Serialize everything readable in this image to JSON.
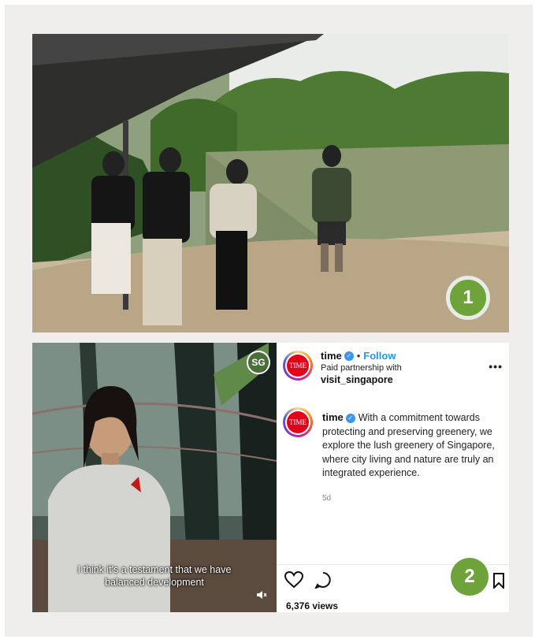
{
  "badges": {
    "first": "1",
    "second": "2"
  },
  "video": {
    "channel_badge": "SG",
    "caption_line1": "I think it's a testament that we have",
    "caption_line2": "balanced development"
  },
  "post": {
    "username": "time",
    "verified_mark": "✓",
    "separator": "•",
    "follow_label": "Follow",
    "partnership_label": "Paid partnership with",
    "partner_name": "visit_singapore",
    "avatar_text": "TIME",
    "caption_username": "time",
    "caption_text": "With a commitment towards protecting and preserving greenery, we explore the lush greenery of Singapore, where city living and nature are truly an integrated experience.",
    "time_ago": "5d",
    "more_label": "•••",
    "views": "6,376 views"
  },
  "colors": {
    "badge_green": "#6ea33b",
    "follow_blue": "#1d9bf0",
    "verified_blue": "#3897f0"
  }
}
